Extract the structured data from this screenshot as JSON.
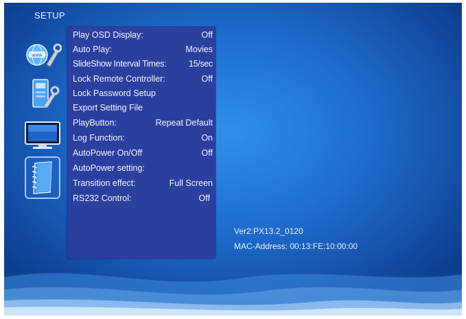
{
  "header": {
    "title": "SETUP"
  },
  "categories": [
    {
      "name": "network-settings",
      "icon": "globe-wrench-icon"
    },
    {
      "name": "device-settings",
      "icon": "device-wrench-icon"
    },
    {
      "name": "display-settings",
      "icon": "tv-monitor-icon"
    },
    {
      "name": "system-settings",
      "icon": "notebook-icon",
      "selected": true
    }
  ],
  "menu": {
    "items": [
      {
        "label": "Play OSD Display:",
        "value": "Off"
      },
      {
        "label": "Auto Play:",
        "value": "Movies"
      },
      {
        "label": "SlideShow Interval Times:",
        "value": "15/sec"
      },
      {
        "label": "Lock Remote Controller:",
        "value": "Off"
      },
      {
        "label": "Lock Password Setup",
        "value": ""
      },
      {
        "label": "Export Setting File",
        "value": ""
      },
      {
        "label": "PlayButton:",
        "value": "Repeat Default"
      },
      {
        "label": "Log Function:",
        "value": "On"
      },
      {
        "label": "AutoPower On/Off",
        "value": "Off"
      },
      {
        "label": "AutoPower setting:",
        "value": ""
      },
      {
        "label": "Transition effect:",
        "value": "Full Screen"
      },
      {
        "label": "RS232 Control:",
        "value": "Off"
      }
    ]
  },
  "info": {
    "version": "Ver2:PX13.2_0120",
    "mac": "MAC-Address: 00:13:FE:10:00:00"
  },
  "colors": {
    "background": "#1f6fd0",
    "menu_panel": "#2b3f9f",
    "text": "#f4f6ff"
  }
}
